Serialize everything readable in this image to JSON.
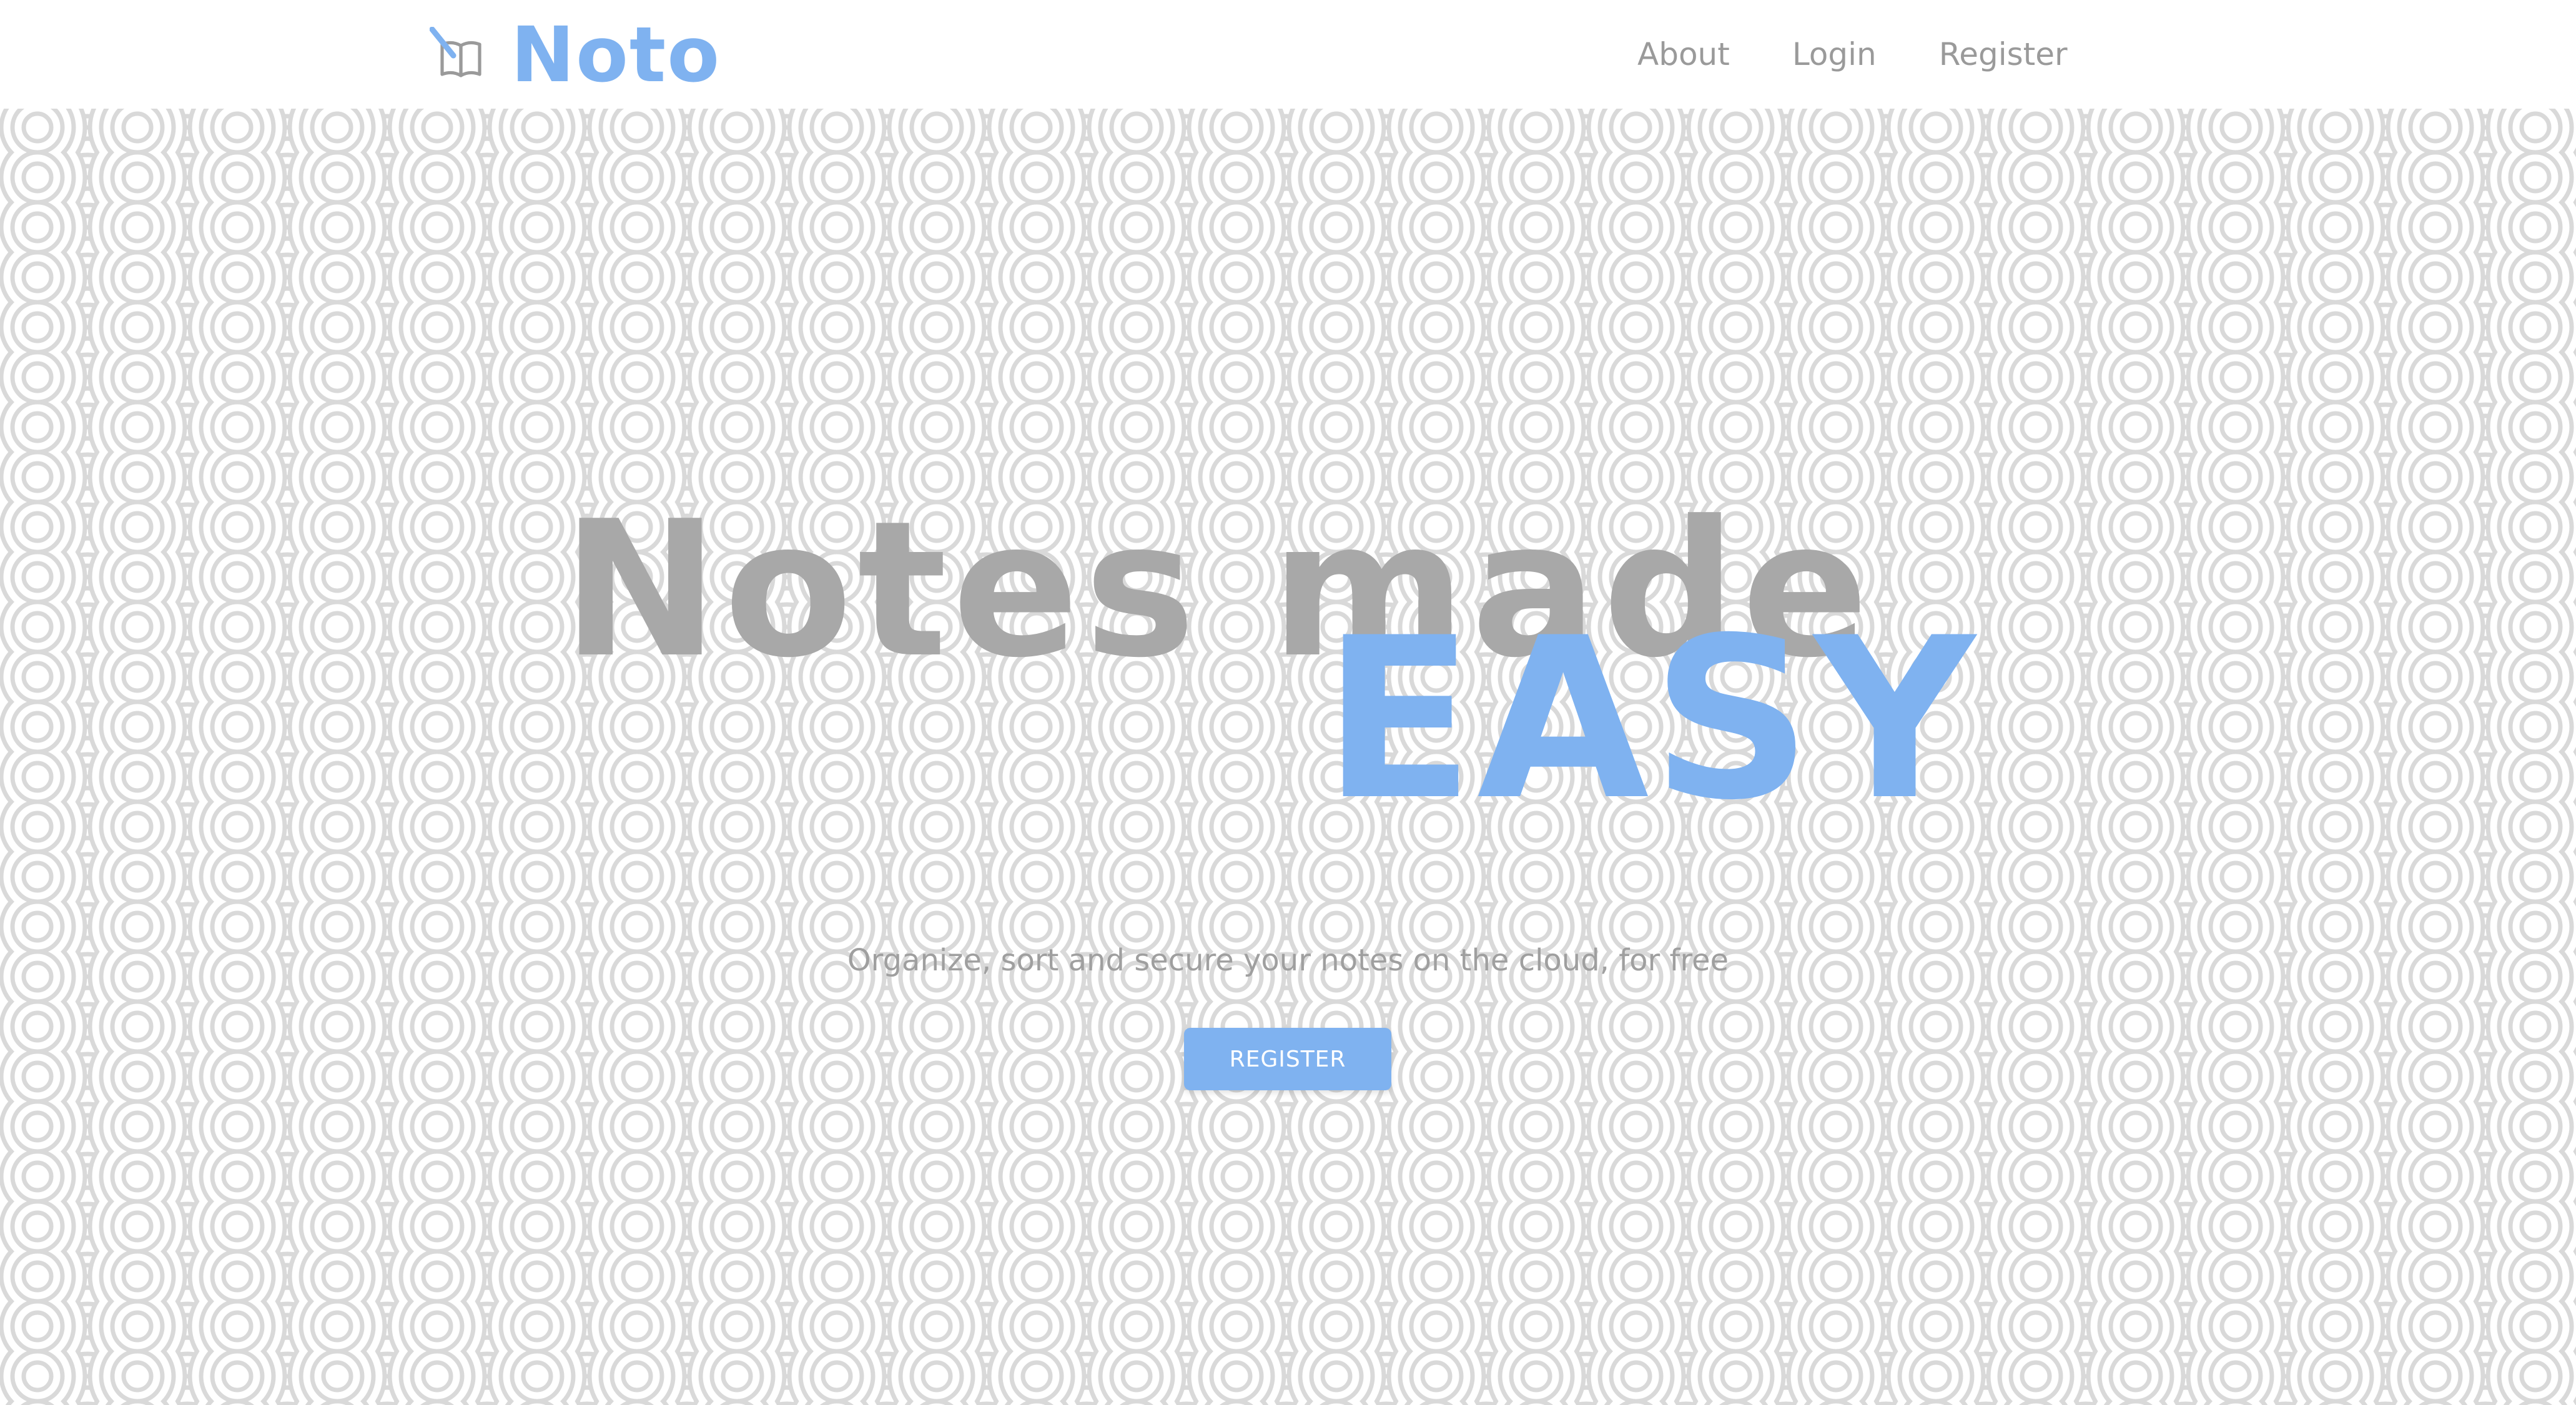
{
  "colors": {
    "accent": "#7fb2f0",
    "headline_gray": "#a8a8a8",
    "nav_text": "#9a9a9a",
    "pattern_stroke": "#d9d9d9",
    "button_text": "#ffffff"
  },
  "navbar": {
    "brand": {
      "icon": "book-pen-icon",
      "name": "Noto"
    },
    "links": [
      {
        "label": "About"
      },
      {
        "label": "Login"
      },
      {
        "label": "Register"
      }
    ]
  },
  "hero": {
    "background_pattern": "seigaiha-wave-pattern",
    "headline_line1": "Notes made",
    "headline_line2": "EASY",
    "tagline": "Organize, sort and secure your notes on the cloud, for free",
    "cta_label": "REGISTER"
  }
}
